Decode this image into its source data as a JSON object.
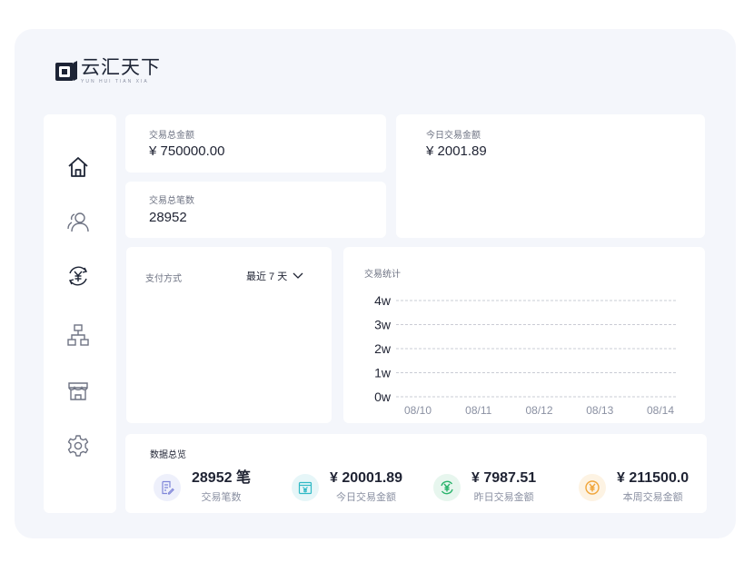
{
  "brand": {
    "name_cn": "云汇天下",
    "name_en": "YUN HUI TIAN XIA"
  },
  "sidebar": {
    "items": [
      {
        "icon": "home-icon"
      },
      {
        "icon": "users-icon"
      },
      {
        "icon": "yuan-transfer-icon"
      },
      {
        "icon": "org-chart-icon"
      },
      {
        "icon": "store-icon"
      },
      {
        "icon": "settings-icon"
      }
    ]
  },
  "stats": {
    "total_amount": {
      "label": "交易总金额",
      "value": "¥ 750000.00"
    },
    "total_count": {
      "label": "交易总笔数",
      "value": "28952"
    },
    "today_amount": {
      "label": "今日交易金额",
      "value": "¥ 2001.89"
    }
  },
  "payment": {
    "label": "支付方式",
    "range_label": "最近 7 天"
  },
  "chart_data": {
    "type": "line",
    "title": "交易统计",
    "y_ticks": [
      "0w",
      "1w",
      "2w",
      "3w",
      "4w"
    ],
    "ylim": [
      0,
      4
    ],
    "categories": [
      "08/10",
      "08/11",
      "08/12",
      "08/13",
      "08/14"
    ],
    "series": [],
    "grid": true,
    "grid_style": "dashed"
  },
  "summary": {
    "title": "数据总览",
    "items": [
      {
        "value": "28952 笔",
        "label": "交易笔数",
        "icon": "document-edit-icon",
        "color": "#7f86d9",
        "bg": "#eef0fb"
      },
      {
        "value": "¥ 20001.89",
        "label": "今日交易金额",
        "icon": "yuan-calendar-icon",
        "color": "#2fb9c5",
        "bg": "#e6f6f8"
      },
      {
        "value": "¥ 7987.51",
        "label": "昨日交易金额",
        "icon": "yuan-refresh-icon",
        "color": "#29b36b",
        "bg": "#e7f6ee"
      },
      {
        "value": "¥ 211500.0",
        "label": "本周交易金额",
        "icon": "yuan-coin-icon",
        "color": "#f0a53a",
        "bg": "#fdf3e3"
      }
    ]
  }
}
